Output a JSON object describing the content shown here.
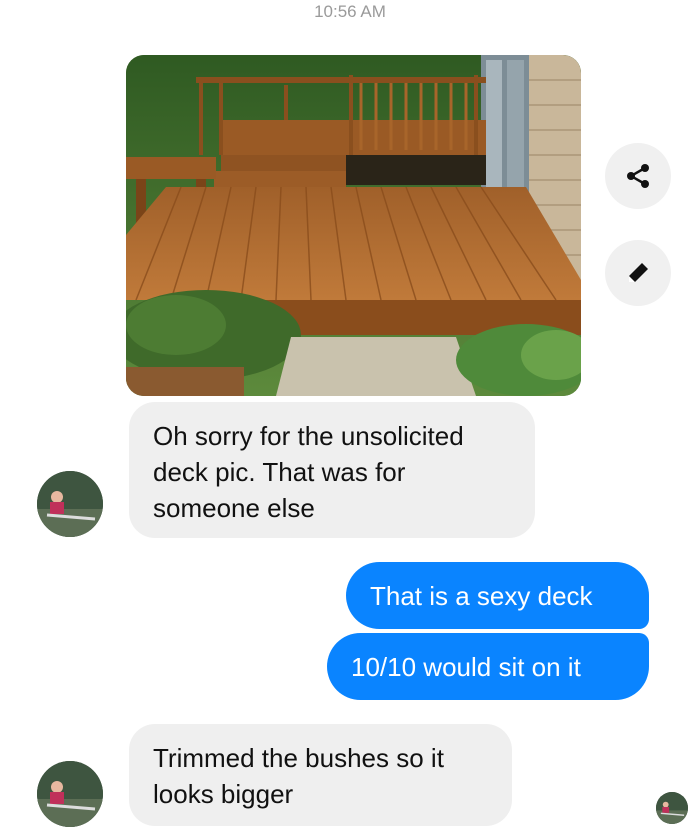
{
  "header": {
    "time": "10:56 AM"
  },
  "photo": {
    "subject": "wooden-deck-photo"
  },
  "actions": {
    "share_icon": "share-icon",
    "edit_icon": "pencil-icon"
  },
  "messages": [
    {
      "from": "them",
      "text": "Oh sorry for the unsolicited deck pic. That was for someone else"
    },
    {
      "from": "me",
      "text": "That is a sexy deck"
    },
    {
      "from": "me",
      "text": "10/10 would sit on it"
    },
    {
      "from": "them",
      "text": "Trimmed the bushes so it looks bigger"
    }
  ],
  "colors": {
    "outgoing": "#0a84ff",
    "incoming": "#efefef",
    "time": "#9a9a9a"
  }
}
